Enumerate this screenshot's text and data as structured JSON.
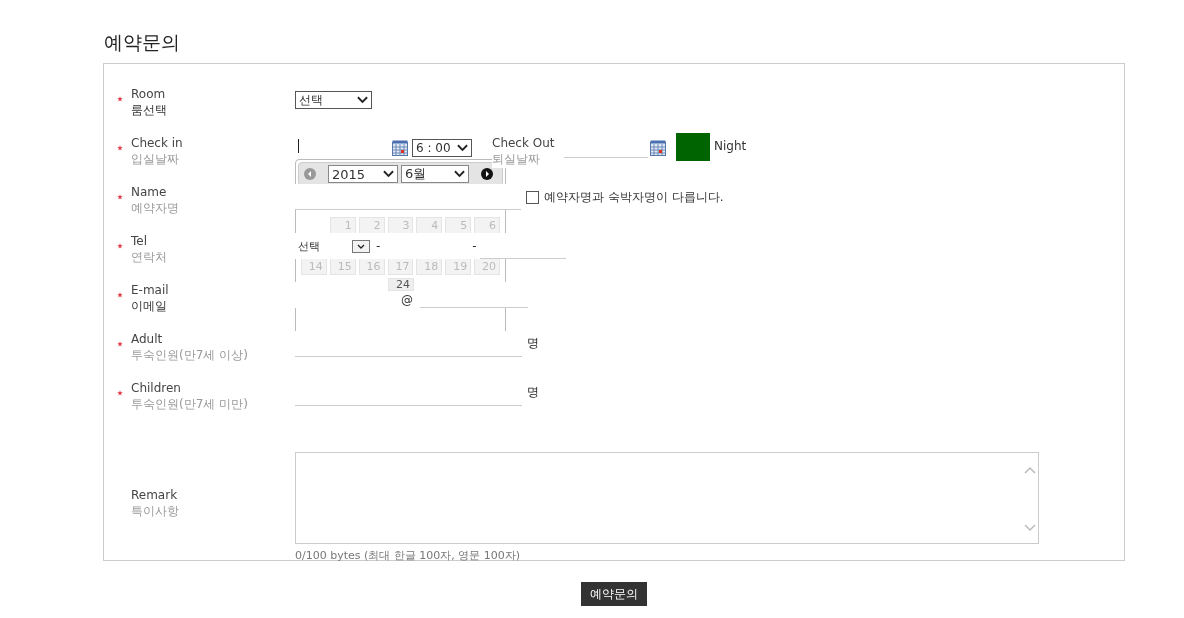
{
  "title": "예약문의",
  "fields": [
    {
      "kind": "select",
      "label": "Room",
      "sublabel": "룸선택",
      "required": true,
      "value": "선택"
    },
    {
      "kind": "dates",
      "label": "Check in",
      "sublabel": "입실날짜",
      "required": true,
      "time": "6 : 00",
      "checkout_label": "Check Out",
      "checkout_sublabel": "퇴실날짜",
      "nights_label": "Night"
    },
    {
      "kind": "name",
      "label": "Name",
      "sublabel": "예약자명",
      "required": true,
      "checkbox": {
        "checked": false,
        "label": "예약자명과 숙박자명이 다릅니다."
      }
    },
    {
      "kind": "tel",
      "label": "Tel",
      "sublabel": "연락처",
      "required": true,
      "value": "선택",
      "separators": [
        "-",
        "-"
      ]
    },
    {
      "kind": "email",
      "label": "E-mail",
      "sublabel": "이메일",
      "required": true,
      "separator": "@"
    },
    {
      "kind": "count",
      "label": "Adult",
      "sublabel": "투숙인원(만7세 이상)",
      "required": true,
      "unit": "명"
    },
    {
      "kind": "count",
      "label": "Children",
      "sublabel": "투숙인원(만7세 미만)",
      "required": true,
      "unit": "명"
    },
    {
      "kind": "textarea",
      "label": "Remark",
      "sublabel": "특이사항",
      "required": false,
      "counter": "0/100 bytes (최대 한글 100자, 영문 100자)"
    }
  ],
  "calendar": {
    "year": "2015",
    "month": "6월",
    "weeks": [
      [
        {
          "kind": "blank"
        },
        {
          "kind": "day",
          "day": "1"
        },
        {
          "kind": "day",
          "day": "2"
        },
        {
          "kind": "day",
          "day": "3"
        },
        {
          "kind": "day",
          "day": "4"
        },
        {
          "kind": "day",
          "day": "5"
        },
        {
          "kind": "day",
          "day": "6"
        }
      ],
      [
        {
          "kind": "day",
          "day": "14"
        },
        {
          "kind": "day",
          "day": "15"
        },
        {
          "kind": "day",
          "day": "16"
        },
        {
          "kind": "day",
          "day": "17"
        },
        {
          "kind": "day",
          "day": "18"
        },
        {
          "kind": "day",
          "day": "19"
        },
        {
          "kind": "day",
          "day": "20"
        }
      ],
      [
        {
          "kind": "blank"
        },
        {
          "kind": "blank"
        },
        {
          "kind": "blank"
        },
        {
          "kind": "day",
          "day": "24"
        }
      ]
    ]
  },
  "submit": "예약문의"
}
